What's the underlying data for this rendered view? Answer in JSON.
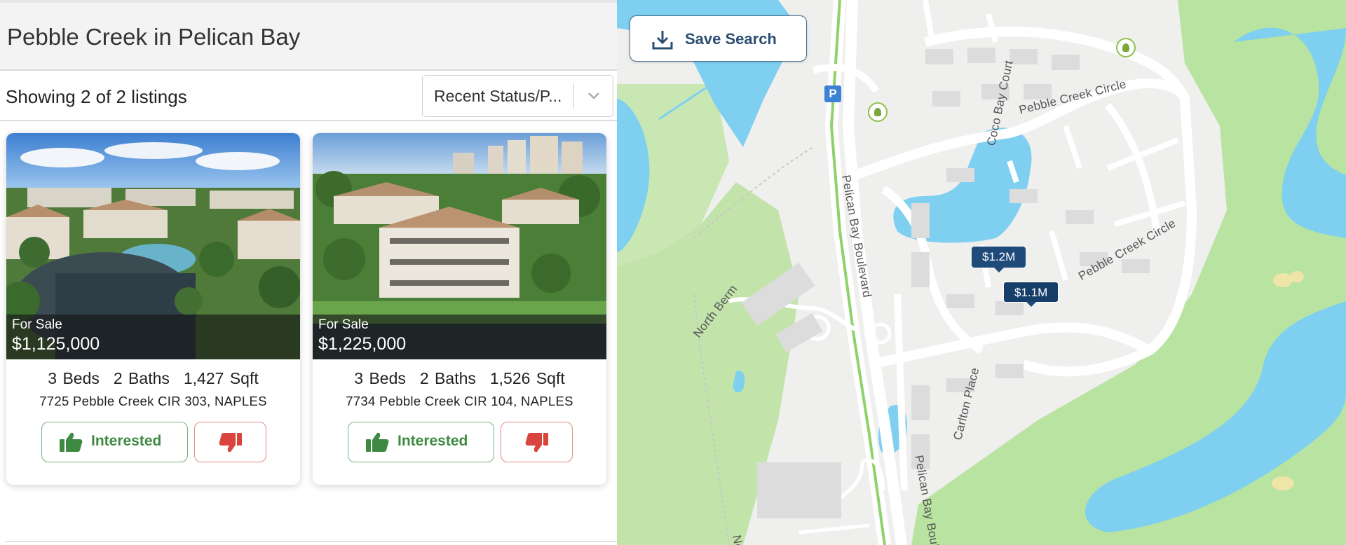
{
  "page": {
    "title": "Pebble Creek in Pelican Bay"
  },
  "listings_header": {
    "showing": "Showing 2 of 2 listings",
    "sort_value": "Recent Status/P..."
  },
  "listings": [
    {
      "status": "For Sale",
      "price": "$1,125,000",
      "beds": "3 Beds",
      "baths": "2 Baths",
      "sqft": "1,427 Sqft",
      "address": "7725 Pebble Creek CIR 303, NAPLES",
      "interested_label": "Interested"
    },
    {
      "status": "For Sale",
      "price": "$1,225,000",
      "beds": "3 Beds",
      "baths": "2 Baths",
      "sqft": "1,526 Sqft",
      "address": "7734 Pebble Creek CIR 104, NAPLES",
      "interested_label": "Interested"
    }
  ],
  "map": {
    "save_search_label": "Save Search",
    "pins": [
      "$1.2M",
      "$1.1M"
    ],
    "labels": {
      "pebble_creek_circle_top": "Pebble Creek Circle",
      "pebble_creek_circle_right": "Pebble Creek Circle",
      "coco_bay": "Coco Bay Court",
      "pelican_bay_blvd": "Pelican Bay Boulevard",
      "pelican_bay_blvd_bottom": "Pelican Bay Boul",
      "north_berm": "North Berm",
      "north_berm_bottom": "No",
      "carlton": "Carlton Place"
    },
    "parking_label": "P"
  },
  "colors": {
    "interested": "#3f8a43",
    "dislike": "#d9443f",
    "pin": "#1f4b7a",
    "water": "#7fd0f0",
    "green": "#b9e3a0"
  }
}
